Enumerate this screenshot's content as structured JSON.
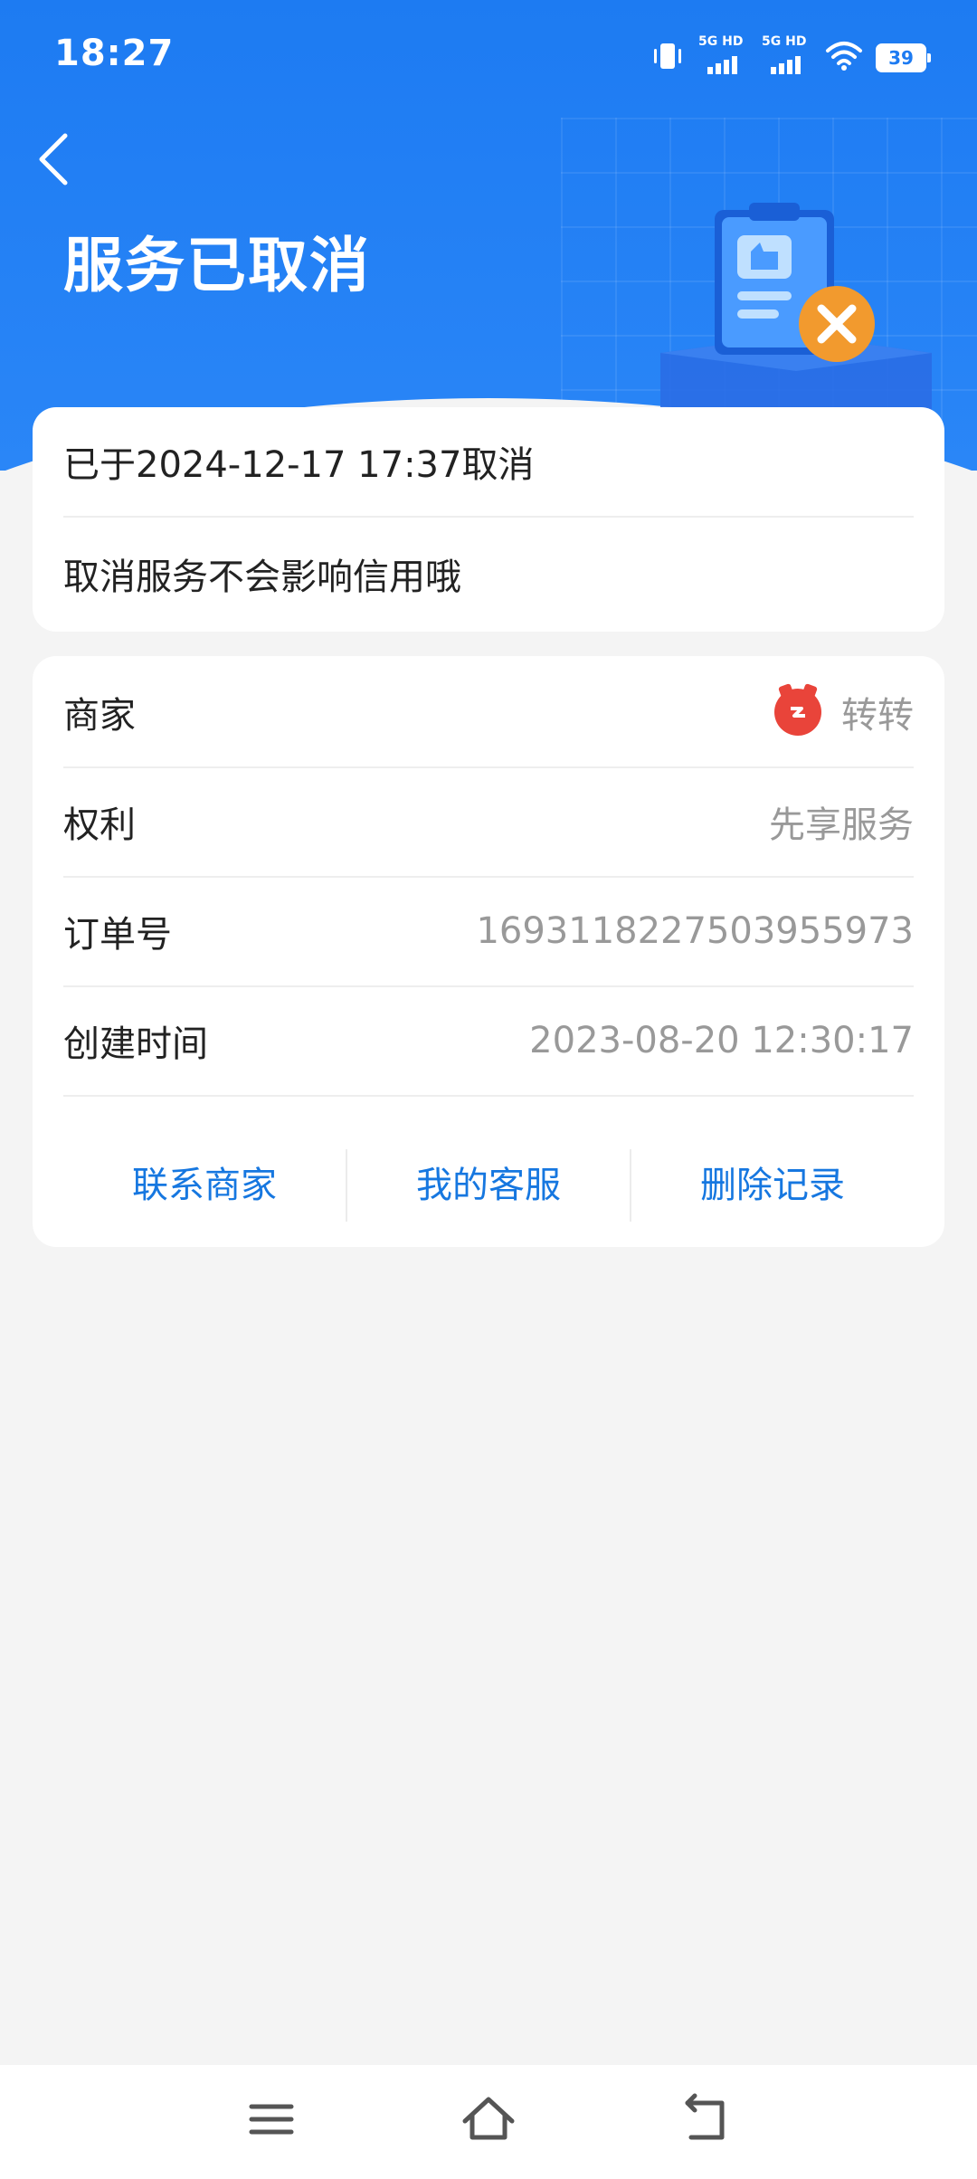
{
  "status_bar": {
    "time": "18:27",
    "signal1_label": "5G HD",
    "signal2_label": "5G HD",
    "battery": "39",
    "icons": [
      "vibrate-icon",
      "signal-icon",
      "signal-icon",
      "wifi-icon",
      "battery-icon"
    ]
  },
  "header": {
    "title": "服务已取消",
    "back_icon": "chevron-left-icon",
    "illustration": "cancelled-clipboard-icon"
  },
  "cancel_info": {
    "cancel_time_text": "已于2024-12-17 17:37取消",
    "note": "取消服务不会影响信用哦"
  },
  "details": {
    "merchant_label": "商家",
    "merchant_name": "转转",
    "rights_label": "权利",
    "rights_value": "先享服务",
    "order_no_label": "订单号",
    "order_no_value": "1693118227503955973",
    "created_label": "创建时间",
    "created_value": "2023-08-20 12:30:17"
  },
  "actions": {
    "contact_merchant": "联系商家",
    "my_service": "我的客服",
    "delete_record": "删除记录"
  },
  "nav_bar": {
    "icons": [
      "menu-icon",
      "home-icon",
      "back-icon"
    ]
  },
  "colors": {
    "header_blue": "#1d7bf2",
    "action_blue": "#1677e0",
    "badge_orange": "#f29a2e",
    "merchant_red": "#e9443a"
  }
}
